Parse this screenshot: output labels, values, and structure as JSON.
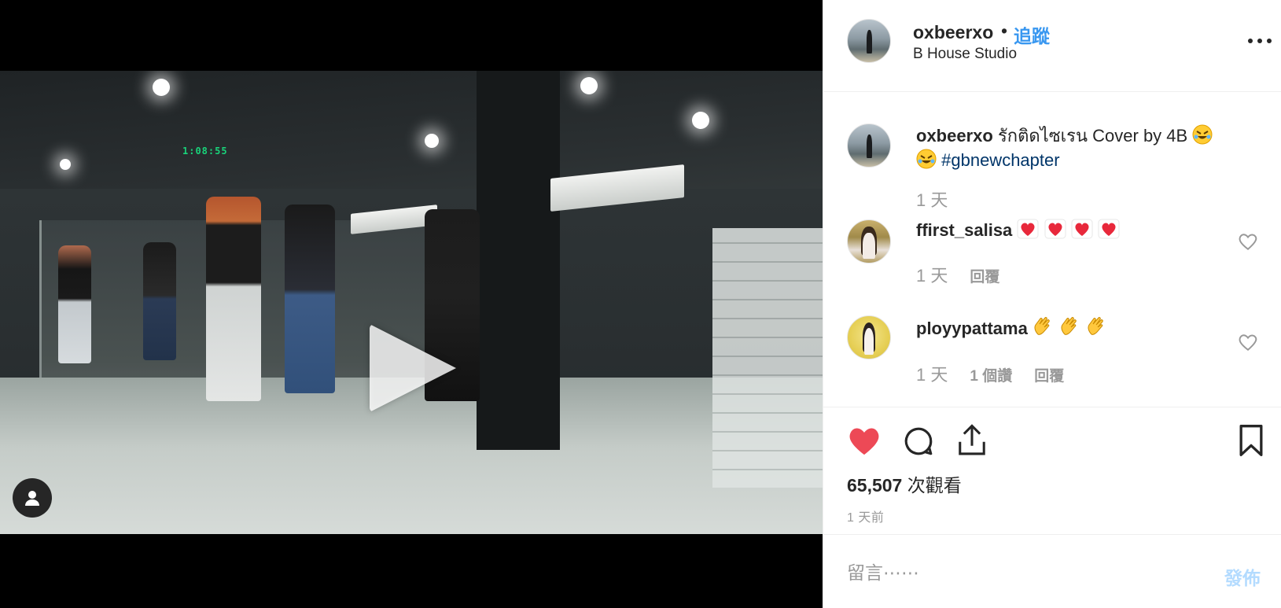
{
  "video": {
    "clock_text": "1:08:55"
  },
  "header": {
    "username": "oxbeerxo",
    "separator": "•",
    "follow_label": "追蹤",
    "location": "B House Studio"
  },
  "caption": {
    "username": "oxbeerxo",
    "text": "รักติดไซเรน Cover by 4B",
    "hashtag": "#gbnewchapter",
    "time": "1 天"
  },
  "comments": [
    {
      "username": "ffirst_salisa",
      "emoji": [
        "heart",
        "heart",
        "heart",
        "heart"
      ],
      "time": "1 天",
      "likes": "",
      "reply_label": "回覆"
    },
    {
      "username": "ployypattama",
      "emoji": [
        "clap",
        "clap",
        "clap"
      ],
      "time": "1 天",
      "likes": "1 個讚",
      "reply_label": "回覆"
    }
  ],
  "stats": {
    "views_count": "65,507",
    "views_label": "次觀看",
    "posted_ago": "1 天前"
  },
  "composer": {
    "placeholder": "留言⋯⋯",
    "post_label": "發佈"
  },
  "colors": {
    "accent": "#3897f0",
    "like_red": "#ed4956",
    "hashtag": "#003569",
    "muted": "#999999",
    "post_disabled": "#b3dbff"
  }
}
